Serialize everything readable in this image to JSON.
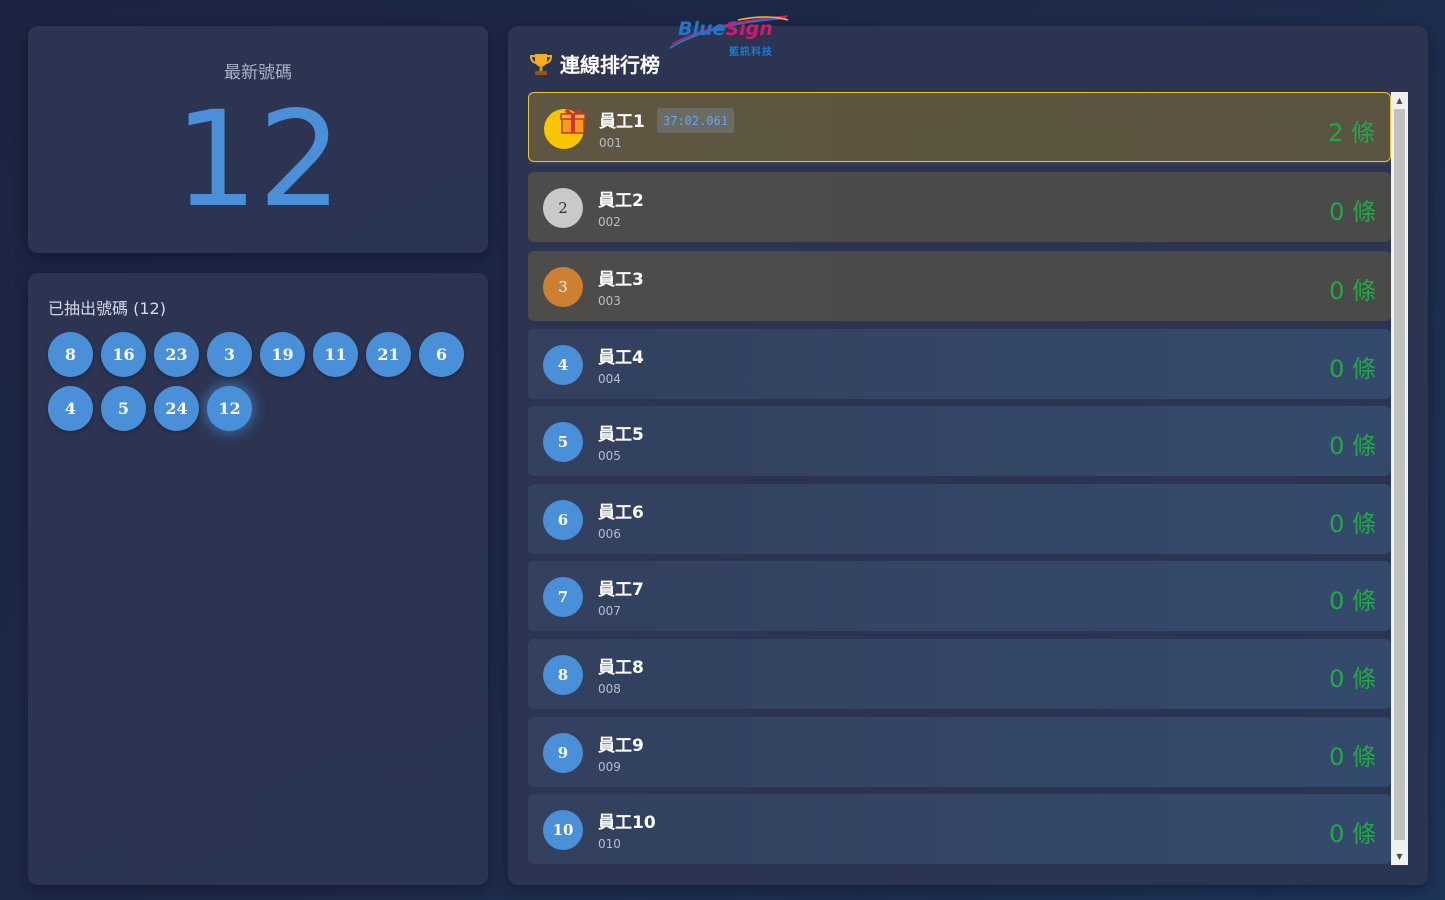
{
  "latest": {
    "label": "最新號碼",
    "number": "12"
  },
  "drawn": {
    "title": "已抽出號碼 (12)",
    "numbers": [
      "8",
      "16",
      "23",
      "3",
      "19",
      "11",
      "21",
      "6",
      "4",
      "5",
      "24",
      "12"
    ]
  },
  "ranking": {
    "title": "連線排行榜",
    "trophy_icon": "trophy-icon",
    "logo": {
      "main_a": "Blue",
      "main_b": "Sign",
      "sub": "藍訊科技"
    },
    "rows": [
      {
        "rank": "1",
        "name": "員工1",
        "code": "001",
        "lines": "2 條",
        "time": "37:02.061"
      },
      {
        "rank": "2",
        "name": "員工2",
        "code": "002",
        "lines": "0 條"
      },
      {
        "rank": "3",
        "name": "員工3",
        "code": "003",
        "lines": "0 條"
      },
      {
        "rank": "4",
        "name": "員工4",
        "code": "004",
        "lines": "0 條"
      },
      {
        "rank": "5",
        "name": "員工5",
        "code": "005",
        "lines": "0 條"
      },
      {
        "rank": "6",
        "name": "員工6",
        "code": "006",
        "lines": "0 條"
      },
      {
        "rank": "7",
        "name": "員工7",
        "code": "007",
        "lines": "0 條"
      },
      {
        "rank": "8",
        "name": "員工8",
        "code": "008",
        "lines": "0 條"
      },
      {
        "rank": "9",
        "name": "員工9",
        "code": "009",
        "lines": "0 條"
      },
      {
        "rank": "10",
        "name": "員工10",
        "code": "010",
        "lines": "0 條"
      }
    ]
  },
  "colors": {
    "accent": "#4a90d9",
    "lines": "#22a845",
    "gold": "#f7c600",
    "silver": "#c9c9c9",
    "bronze": "#cd7f32"
  }
}
